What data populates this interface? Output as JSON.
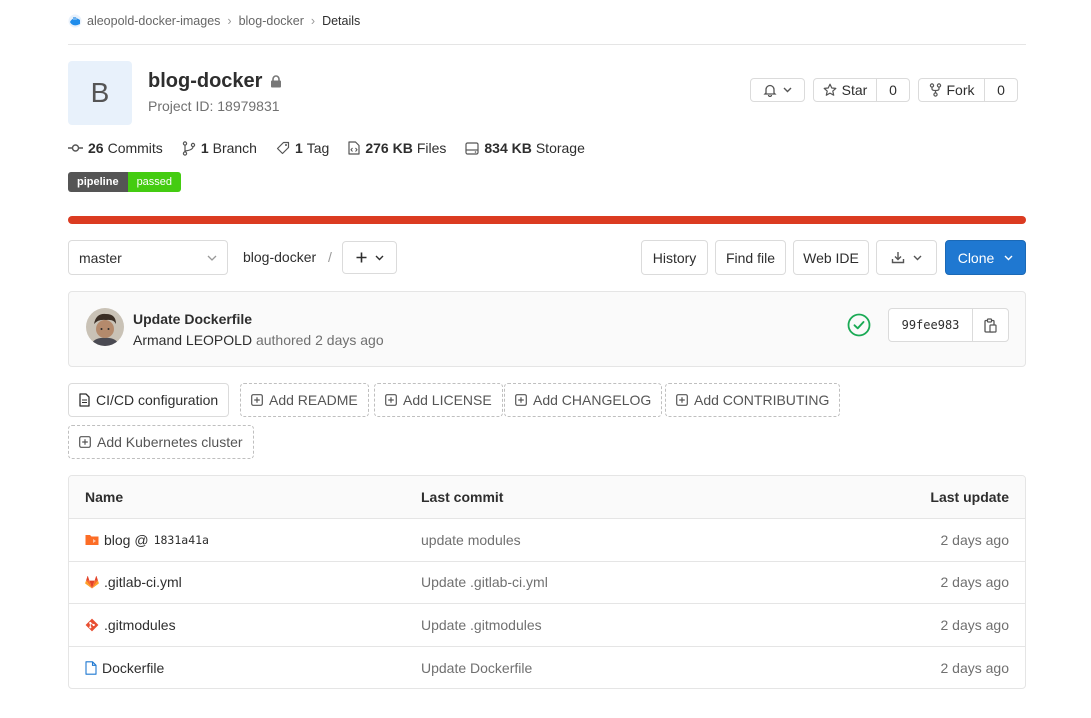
{
  "breadcrumb": {
    "group": "aleopold-docker-images",
    "project": "blog-docker",
    "current": "Details"
  },
  "project": {
    "avatar_letter": "B",
    "name": "blog-docker",
    "id_text": "Project ID: 18979831"
  },
  "actions": {
    "star_label": "Star",
    "star_count": "0",
    "fork_label": "Fork",
    "fork_count": "0"
  },
  "stats": {
    "commits_count": "26",
    "commits_label": "Commits",
    "branch_count": "1",
    "branch_label": "Branch",
    "tag_count": "1",
    "tag_label": "Tag",
    "files_size": "276 KB",
    "files_label": "Files",
    "storage_size": "834 KB",
    "storage_label": "Storage"
  },
  "pipeline_badge": {
    "label": "pipeline",
    "status": "passed"
  },
  "toolbar": {
    "branch": "master",
    "path": "blog-docker",
    "path_sep": "/",
    "history": "History",
    "find_file": "Find file",
    "web_ide": "Web IDE",
    "clone": "Clone"
  },
  "last_commit": {
    "title": "Update Dockerfile",
    "author": "Armand LEOPOLD",
    "meta": "authored 2 days ago",
    "sha": "99fee983"
  },
  "quick_actions": [
    "CI/CD configuration",
    "Add README",
    "Add LICENSE",
    "Add CHANGELOG",
    "Add CONTRIBUTING",
    "Add Kubernetes cluster"
  ],
  "table": {
    "headers": {
      "name": "Name",
      "last_commit": "Last commit",
      "last_update": "Last update"
    },
    "rows": [
      {
        "name": "blog @",
        "submodule_sha": "1831a41a",
        "commit": "update modules",
        "updated": "2 days ago",
        "icon": "submodule-folder-icon"
      },
      {
        "name": ".gitlab-ci.yml",
        "commit": "Update .gitlab-ci.yml",
        "updated": "2 days ago",
        "icon": "gitlab-ci-icon"
      },
      {
        "name": ".gitmodules",
        "commit": "Update .gitmodules",
        "updated": "2 days ago",
        "icon": "git-icon"
      },
      {
        "name": "Dockerfile",
        "commit": "Update Dockerfile",
        "updated": "2 days ago",
        "icon": "file-icon"
      }
    ]
  },
  "colors": {
    "pipeline_bar": "#db3b21",
    "clone_button": "#1f78d1",
    "badge_passed": "#44cc11",
    "success_check": "#1aaa55"
  }
}
